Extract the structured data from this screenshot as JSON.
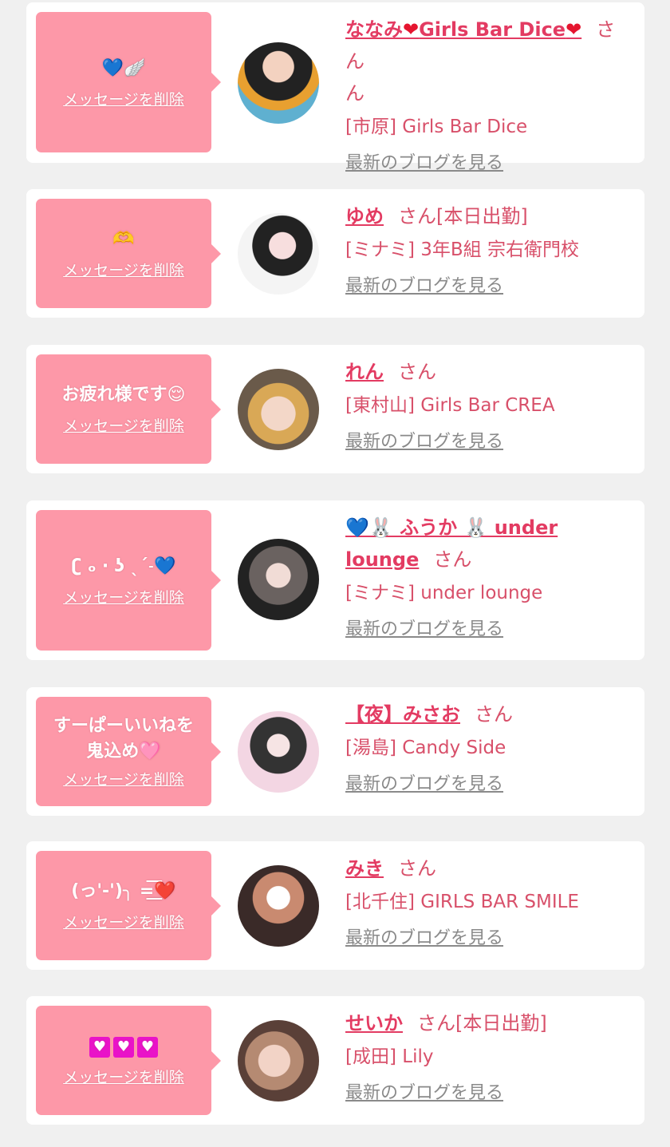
{
  "delete_label": "メッセージを削除",
  "blog_label": "最新のブログを見る",
  "cards": [
    {
      "message": "💙🪽",
      "name": "ななみ❤️Girls Bar Dice❤️",
      "suffix": "さん",
      "suffix2": "ん",
      "shop": "[市原] Girls Bar Dice"
    },
    {
      "message": "🫶",
      "name": "ゆめ",
      "suffix": "さん[本日出勤]",
      "shop": "[ミナミ] 3年B組 宗右衛門校"
    },
    {
      "message": "お疲れ様です😌",
      "name": "れん",
      "suffix": "さん",
      "shop": "[東村山] Girls Bar CREA"
    },
    {
      "message": "ʗ ₒ ‧ ʖ ˎˊ˗💙",
      "name": "💙🐰 ふうか 🐰 under",
      "name2": "lounge",
      "suffix": "さん",
      "shop": "[ミナミ] under lounge"
    },
    {
      "message_line1": "すーぱーいいねを",
      "message_line2": "鬼込め🩷",
      "name": "【夜】みさお",
      "suffix": "さん",
      "shop": "[湯島] Candy Side"
    },
    {
      "message": "(っ'-')╮ =͟͟͞❤️",
      "name": "みき",
      "suffix": "さん",
      "shop": "[北千住] GIRLS BAR SMILE"
    },
    {
      "message": "💟💟💟",
      "name": "せいか",
      "suffix": "さん[本日出勤]",
      "shop": "[成田] Lily"
    }
  ],
  "colors": {
    "bubble": "#fd98a8",
    "name": "#e33b62",
    "text": "#d8506a",
    "link_gray": "#8a8a8a"
  }
}
